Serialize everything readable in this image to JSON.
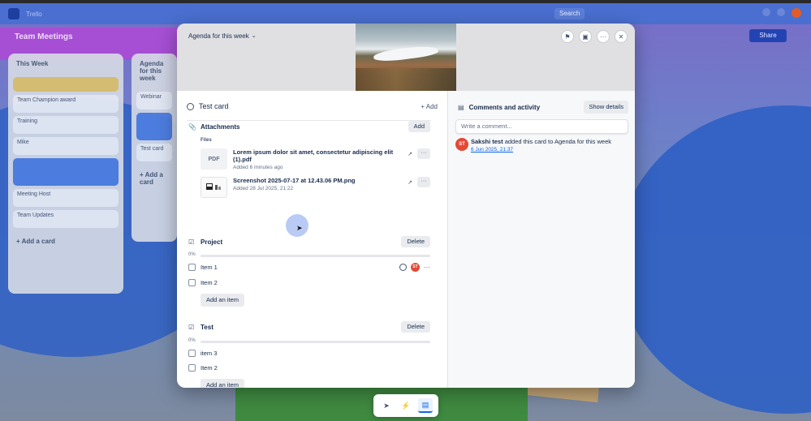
{
  "app": {
    "name": "Trello"
  },
  "topbar": {
    "search_label": "Search"
  },
  "board": {
    "title": "Team Meetings",
    "share_label": "Share",
    "lists": [
      {
        "title": "This Week",
        "cards": [
          "",
          "Team Champion award",
          "Training",
          "Mike",
          "",
          "Meeting Host",
          "Team Updates"
        ],
        "add_label": "+ Add a card"
      },
      {
        "title": "Agenda for this week",
        "cards": [
          "Webinar",
          "",
          "Test card"
        ],
        "add_label": "+ Add a card"
      }
    ]
  },
  "modal": {
    "list_name": "Agenda for this week",
    "card_title": "Test card",
    "add_label": "+ Add",
    "attachments": {
      "title": "Attachments",
      "add_label": "Add",
      "files_label": "Files",
      "files": [
        {
          "thumb": "PDF",
          "name": "Lorem ipsum dolor sit amet, consectetur adipiscing elit (1).pdf",
          "date": "Added 6 minutes ago"
        },
        {
          "thumb": "",
          "name": "Screenshot 2025-07-17 at 12.43.06 PM.png",
          "date": "Added 28 Jul 2025, 21:22"
        }
      ]
    },
    "checklists": [
      {
        "title": "Project",
        "delete_label": "Delete",
        "progress_label": "0%",
        "progress": 0,
        "items": [
          {
            "label": "Item 1",
            "avatar": "ST"
          },
          {
            "label": "Item 2"
          }
        ],
        "add_label": "Add an item"
      },
      {
        "title": "Test",
        "delete_label": "Delete",
        "progress_label": "0%",
        "progress": 0,
        "items": [
          {
            "label": "item 3"
          },
          {
            "label": "Item 2"
          }
        ],
        "add_label": "Add an item"
      }
    ],
    "activity": {
      "title": "Comments and activity",
      "show_details_label": "Show details",
      "comment_placeholder": "Write a comment...",
      "entries": [
        {
          "avatar": "ST",
          "user": "Sakshi test",
          "text": " added this card to Agenda for this week",
          "time": "6 Jun 2025, 21:37"
        }
      ]
    }
  },
  "colors": {
    "accent": "#0c66e4",
    "avatar": "#e34935",
    "board_blue": "#2f5fc4"
  },
  "icons": [
    "pin-icon",
    "image-icon",
    "more-icon",
    "close-icon",
    "attachment-icon",
    "checklist-icon",
    "comment-icon",
    "external-link-icon",
    "clock-icon",
    "inbox-icon",
    "bolt-icon",
    "chat-icon"
  ]
}
